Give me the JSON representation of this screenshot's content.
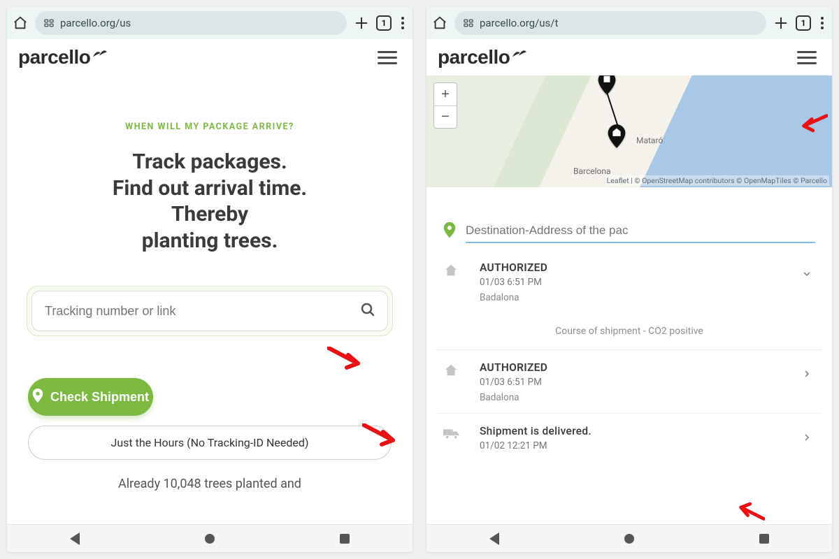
{
  "left": {
    "url": "parcello.org/us",
    "tab_count": "1",
    "brand": "parcello",
    "eyebrow": "WHEN WILL MY PACKAGE ARRIVE?",
    "headline_l1": "Track packages.",
    "headline_l2": "Find out arrival time.",
    "headline_l3": "Thereby",
    "headline_l4": "planting trees.",
    "search_placeholder": "Tracking number or link",
    "cta_primary": "Check Shipment",
    "cta_secondary": "Just the Hours (No Tracking-ID Needed)",
    "footnote": "Already 10,048 trees planted and"
  },
  "right": {
    "url": "parcello.org/us/t",
    "tab_count": "1",
    "brand": "parcello",
    "map": {
      "zoom_in": "+",
      "zoom_out": "−",
      "attribution": "Leaflet | © OpenStreetMap contributors © OpenMapTiles © Parcello",
      "city1": "Barcelona",
      "city2": "Mataró"
    },
    "dest_placeholder": "Destination-Address of the pac",
    "section_caption": "Course of shipment - CO2 positive",
    "events": [
      {
        "status": "AUTHORIZED",
        "when": "01/03 6:51 PM",
        "where": "Badalona",
        "icon": "home",
        "chevron": "down"
      },
      {
        "status": "AUTHORIZED",
        "when": "01/03 6:51 PM",
        "where": "Badalona",
        "icon": "home",
        "chevron": "right"
      },
      {
        "status": "Shipment is delivered.",
        "when": "01/02 12:21 PM",
        "where": "",
        "icon": "truck",
        "chevron": "right"
      }
    ]
  }
}
